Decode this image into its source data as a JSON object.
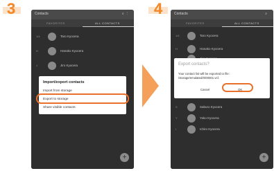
{
  "steps": [
    {
      "number": "3"
    },
    {
      "number": "4"
    }
  ],
  "app": {
    "title": "Contacts",
    "tab_left": "FAVORITES",
    "tab_right": "ALL CONTACTS",
    "icons": [
      "search-icon",
      "more-vert-icon"
    ]
  },
  "contacts": [
    {
      "index": "1/4",
      "name": "Taro Kyocera"
    },
    {
      "index": "H",
      "name": "Hanako Kyocera"
    },
    {
      "index": "J",
      "name": "Jiro Kyocera"
    },
    {
      "index": "S",
      "name": "Saburo Kyocera"
    },
    {
      "index": "Y",
      "name": "Yoko Kyocera"
    },
    {
      "index": "I",
      "name": "Ichiro Kyocera"
    }
  ],
  "dialog_import": {
    "title": "Import/export contacts",
    "options": [
      "Import from storage",
      "Export to storage",
      "Share visible contacts"
    ]
  },
  "dialog_export": {
    "title": "Export contacts?",
    "message": "Your contact list will be exported to file: /storage/emulated/0/00001.vcf.",
    "cancel_label": "Cancel",
    "ok_label": "OK"
  },
  "colors": {
    "accent": "#e8702a",
    "step_number": "#f2892b",
    "arrow": "#f5a05a"
  }
}
